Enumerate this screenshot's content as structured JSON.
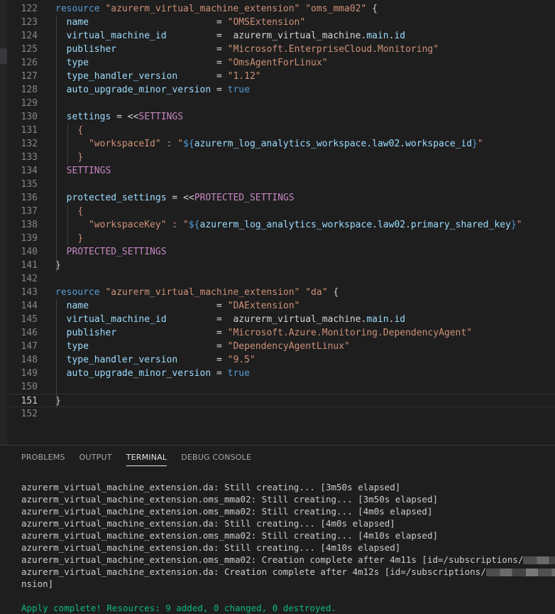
{
  "editor": {
    "lines": [
      {
        "n": "122",
        "tokens": [
          [
            "kw",
            "resource"
          ],
          [
            "ref",
            " "
          ],
          [
            "str",
            "\"azurerm_virtual_machine_extension\""
          ],
          [
            "ref",
            " "
          ],
          [
            "str",
            "\"oms_mma02\""
          ],
          [
            "ref",
            " {"
          ]
        ]
      },
      {
        "n": "123",
        "tokens": [
          [
            "ref",
            "  "
          ],
          [
            "prop",
            "name"
          ],
          [
            "ref",
            "                       = "
          ],
          [
            "str",
            "\"OMSExtension\""
          ]
        ]
      },
      {
        "n": "124",
        "tokens": [
          [
            "ref",
            "  "
          ],
          [
            "prop",
            "virtual_machine_id"
          ],
          [
            "ref",
            "         =  azurerm_virtual_machine."
          ],
          [
            "prop",
            "main"
          ],
          [
            "ref",
            "."
          ],
          [
            "prop",
            "id"
          ]
        ]
      },
      {
        "n": "125",
        "tokens": [
          [
            "ref",
            "  "
          ],
          [
            "prop",
            "publisher"
          ],
          [
            "ref",
            "                  = "
          ],
          [
            "str",
            "\"Microsoft.EnterpriseCloud.Monitoring\""
          ]
        ]
      },
      {
        "n": "126",
        "tokens": [
          [
            "ref",
            "  "
          ],
          [
            "prop",
            "type"
          ],
          [
            "ref",
            "                       = "
          ],
          [
            "str",
            "\"OmsAgentForLinux\""
          ]
        ]
      },
      {
        "n": "127",
        "tokens": [
          [
            "ref",
            "  "
          ],
          [
            "prop",
            "type_handler_version"
          ],
          [
            "ref",
            "       = "
          ],
          [
            "str",
            "\"1.12\""
          ]
        ]
      },
      {
        "n": "128",
        "tokens": [
          [
            "ref",
            "  "
          ],
          [
            "prop",
            "auto_upgrade_minor_version"
          ],
          [
            "ref",
            " = "
          ],
          [
            "kw",
            "true"
          ]
        ]
      },
      {
        "n": "129",
        "tokens": []
      },
      {
        "n": "130",
        "tokens": [
          [
            "ref",
            "  "
          ],
          [
            "prop",
            "settings"
          ],
          [
            "ref",
            " = <<"
          ],
          [
            "heredoc",
            "SETTINGS"
          ]
        ]
      },
      {
        "n": "131",
        "tokens": [
          [
            "ref",
            "    "
          ],
          [
            "str",
            "{"
          ]
        ]
      },
      {
        "n": "132",
        "tokens": [
          [
            "ref",
            "      "
          ],
          [
            "str",
            "\"workspaceId\" : \""
          ],
          [
            "interp",
            "${"
          ],
          [
            "prop",
            "azurerm_log_analytics_workspace.law02.workspace_id"
          ],
          [
            "interp",
            "}"
          ],
          [
            "str",
            "\""
          ]
        ]
      },
      {
        "n": "133",
        "tokens": [
          [
            "ref",
            "    "
          ],
          [
            "str",
            "}"
          ]
        ]
      },
      {
        "n": "134",
        "tokens": [
          [
            "ref",
            "  "
          ],
          [
            "heredoc",
            "SETTINGS"
          ]
        ]
      },
      {
        "n": "135",
        "tokens": []
      },
      {
        "n": "136",
        "tokens": [
          [
            "ref",
            "  "
          ],
          [
            "prop",
            "protected_settings"
          ],
          [
            "ref",
            " = <<"
          ],
          [
            "heredoc",
            "PROTECTED_SETTINGS"
          ]
        ]
      },
      {
        "n": "137",
        "tokens": [
          [
            "ref",
            "    "
          ],
          [
            "str",
            "{"
          ]
        ]
      },
      {
        "n": "138",
        "tokens": [
          [
            "ref",
            "      "
          ],
          [
            "str",
            "\"workspaceKey\" : \""
          ],
          [
            "interp",
            "${"
          ],
          [
            "prop",
            "azurerm_log_analytics_workspace.law02.primary_shared_key"
          ],
          [
            "interp",
            "}"
          ],
          [
            "str",
            "\""
          ]
        ]
      },
      {
        "n": "139",
        "tokens": [
          [
            "ref",
            "    "
          ],
          [
            "str",
            "}"
          ]
        ]
      },
      {
        "n": "140",
        "tokens": [
          [
            "ref",
            "  "
          ],
          [
            "heredoc",
            "PROTECTED_SETTINGS"
          ]
        ]
      },
      {
        "n": "141",
        "tokens": [
          [
            "ref",
            "}"
          ]
        ]
      },
      {
        "n": "142",
        "tokens": []
      },
      {
        "n": "143",
        "tokens": [
          [
            "kw",
            "resource"
          ],
          [
            "ref",
            " "
          ],
          [
            "str",
            "\"azurerm_virtual_machine_extension\""
          ],
          [
            "ref",
            " "
          ],
          [
            "str",
            "\"da\""
          ],
          [
            "ref",
            " {"
          ]
        ]
      },
      {
        "n": "144",
        "tokens": [
          [
            "ref",
            "  "
          ],
          [
            "prop",
            "name"
          ],
          [
            "ref",
            "                       = "
          ],
          [
            "str",
            "\"DAExtension\""
          ]
        ]
      },
      {
        "n": "145",
        "tokens": [
          [
            "ref",
            "  "
          ],
          [
            "prop",
            "virtual_machine_id"
          ],
          [
            "ref",
            "         =  azurerm_virtual_machine."
          ],
          [
            "prop",
            "main"
          ],
          [
            "ref",
            "."
          ],
          [
            "prop",
            "id"
          ]
        ]
      },
      {
        "n": "146",
        "tokens": [
          [
            "ref",
            "  "
          ],
          [
            "prop",
            "publisher"
          ],
          [
            "ref",
            "                  = "
          ],
          [
            "str",
            "\"Microsoft.Azure.Monitoring.DependencyAgent\""
          ]
        ]
      },
      {
        "n": "147",
        "tokens": [
          [
            "ref",
            "  "
          ],
          [
            "prop",
            "type"
          ],
          [
            "ref",
            "                       = "
          ],
          [
            "str",
            "\"DependencyAgentLinux\""
          ]
        ]
      },
      {
        "n": "148",
        "tokens": [
          [
            "ref",
            "  "
          ],
          [
            "prop",
            "type_handler_version"
          ],
          [
            "ref",
            "       = "
          ],
          [
            "str",
            "\"9.5\""
          ]
        ]
      },
      {
        "n": "149",
        "tokens": [
          [
            "ref",
            "  "
          ],
          [
            "prop",
            "auto_upgrade_minor_version"
          ],
          [
            "ref",
            " = "
          ],
          [
            "kw",
            "true"
          ]
        ]
      },
      {
        "n": "150",
        "tokens": []
      },
      {
        "n": "151",
        "tokens": [
          [
            "ref",
            "}"
          ]
        ]
      },
      {
        "n": "152",
        "tokens": []
      }
    ],
    "current_line": "151"
  },
  "panel": {
    "tabs": [
      {
        "id": "problems",
        "label": "PROBLEMS"
      },
      {
        "id": "output",
        "label": "OUTPUT"
      },
      {
        "id": "terminal",
        "label": "TERMINAL",
        "active": true
      },
      {
        "id": "debug-console",
        "label": "DEBUG CONSOLE"
      }
    ],
    "terminal_lines": [
      {
        "text": "azurerm_virtual_machine_extension.da: Still creating... [3m50s elapsed]"
      },
      {
        "text": "azurerm_virtual_machine_extension.oms_mma02: Still creating... [3m50s elapsed]"
      },
      {
        "text": "azurerm_virtual_machine_extension.oms_mma02: Still creating... [4m0s elapsed]"
      },
      {
        "text": "azurerm_virtual_machine_extension.da: Still creating... [4m0s elapsed]"
      },
      {
        "text": "azurerm_virtual_machine_extension.oms_mma02: Still creating... [4m10s elapsed]"
      },
      {
        "text": "azurerm_virtual_machine_extension.da: Still creating... [4m10s elapsed]"
      },
      {
        "text": "azurerm_virtual_machine_extension.oms_mma02: Creation complete after 4m11s [id=/subscriptions/",
        "redacted": true
      },
      {
        "text": "azurerm_virtual_machine_extension.da: Creation complete after 4m12s [id=/subscriptions/",
        "redacted": true
      },
      {
        "text": "nsion]"
      },
      {
        "text": ""
      },
      {
        "text": "Apply complete! Resources: 9 added, 0 changed, 0 destroyed.",
        "green": true
      }
    ]
  }
}
